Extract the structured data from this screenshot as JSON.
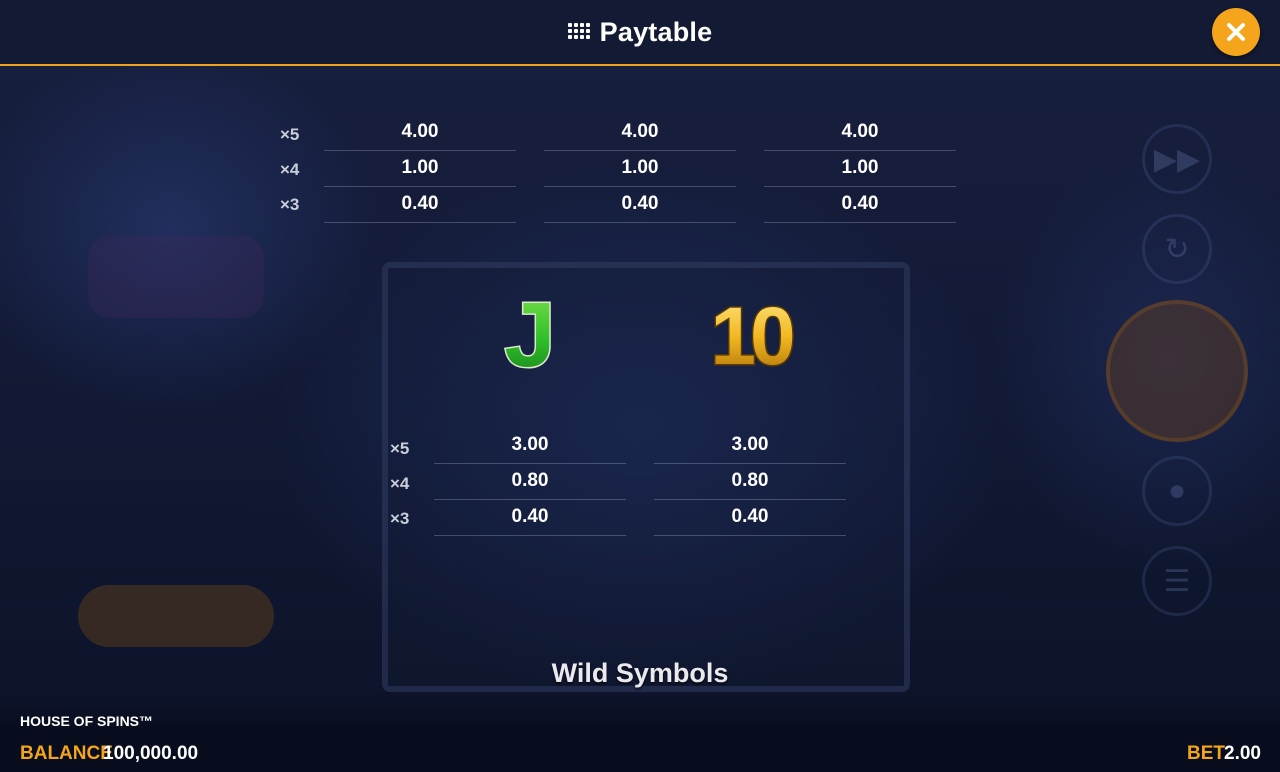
{
  "header": {
    "title": "Paytable",
    "menu_icon": "grid-icon",
    "close_icon": "close-icon",
    "accent_color": "#f5a51c"
  },
  "paytable": {
    "top_group": {
      "multipliers": [
        "×5",
        "×4",
        "×3"
      ],
      "columns": [
        {
          "values": [
            "4.00",
            "1.00",
            "0.40"
          ]
        },
        {
          "values": [
            "4.00",
            "1.00",
            "0.40"
          ]
        },
        {
          "values": [
            "4.00",
            "1.00",
            "0.40"
          ]
        }
      ]
    },
    "middle_group": {
      "symbols": [
        {
          "name": "J",
          "color": "#2fbf2a"
        },
        {
          "name": "10",
          "color": "#f2b820"
        }
      ],
      "multipliers": [
        "×5",
        "×4",
        "×3"
      ],
      "columns": [
        {
          "values": [
            "3.00",
            "0.80",
            "0.40"
          ]
        },
        {
          "values": [
            "3.00",
            "0.80",
            "0.40"
          ]
        }
      ]
    },
    "section_title": "Wild Symbols"
  },
  "footer": {
    "game_name": "HOUSE OF SPINS™",
    "balance_label": "BALANCE",
    "balance_value": "100,000.00",
    "bet_label": "BET",
    "bet_value": "2.00"
  }
}
